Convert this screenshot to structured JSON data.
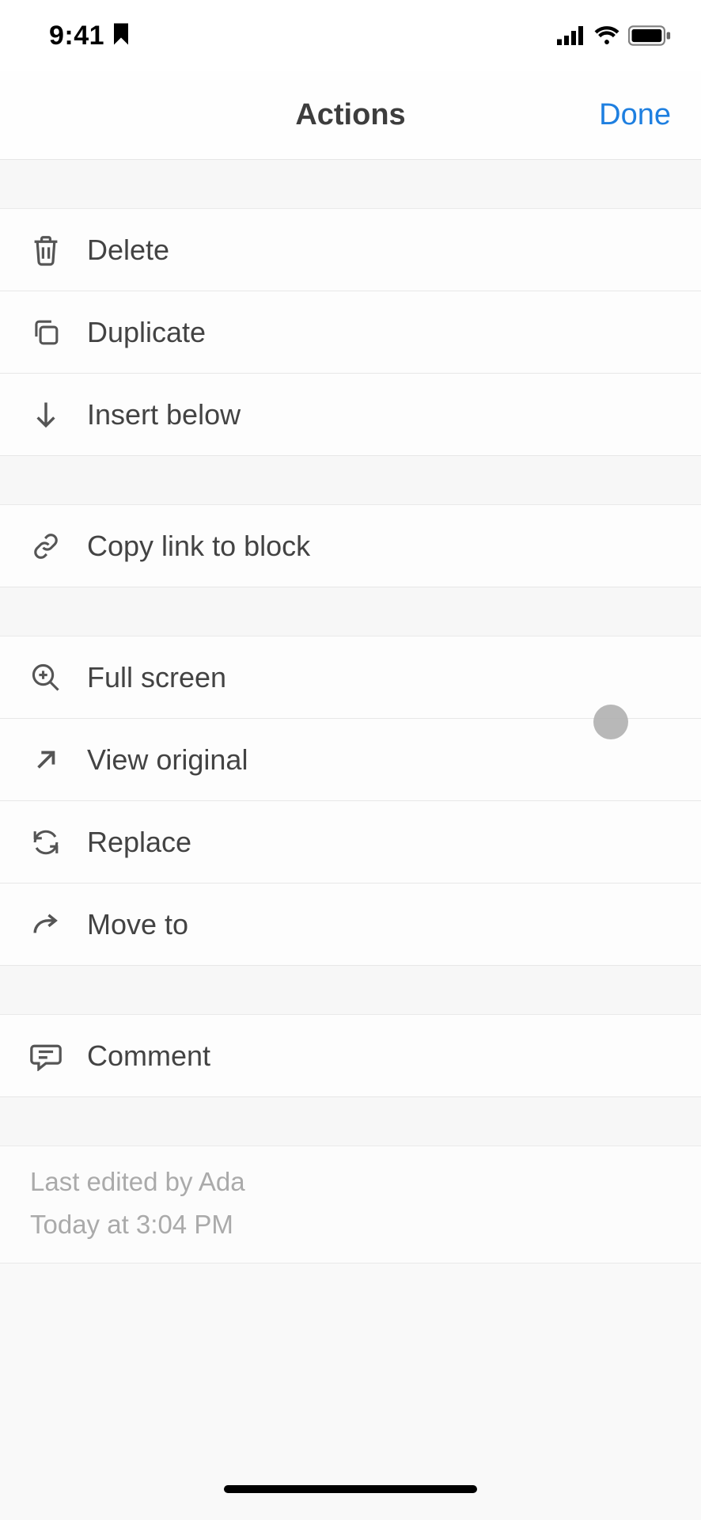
{
  "status": {
    "time": "9:41"
  },
  "header": {
    "title": "Actions",
    "done": "Done"
  },
  "groups": [
    {
      "items": [
        {
          "icon": "trash",
          "label": "Delete"
        },
        {
          "icon": "duplicate",
          "label": "Duplicate"
        },
        {
          "icon": "arrow-down",
          "label": "Insert below"
        }
      ]
    },
    {
      "items": [
        {
          "icon": "link",
          "label": "Copy link to block"
        }
      ]
    },
    {
      "items": [
        {
          "icon": "zoom-plus",
          "label": "Full screen"
        },
        {
          "icon": "arrow-out",
          "label": "View original"
        },
        {
          "icon": "replace",
          "label": "Replace"
        },
        {
          "icon": "arrow-right-curve",
          "label": "Move to"
        }
      ]
    },
    {
      "items": [
        {
          "icon": "comment",
          "label": "Comment"
        }
      ]
    }
  ],
  "meta": {
    "edited_by": "Last edited by Ada",
    "edited_at": "Today at 3:04 PM"
  }
}
